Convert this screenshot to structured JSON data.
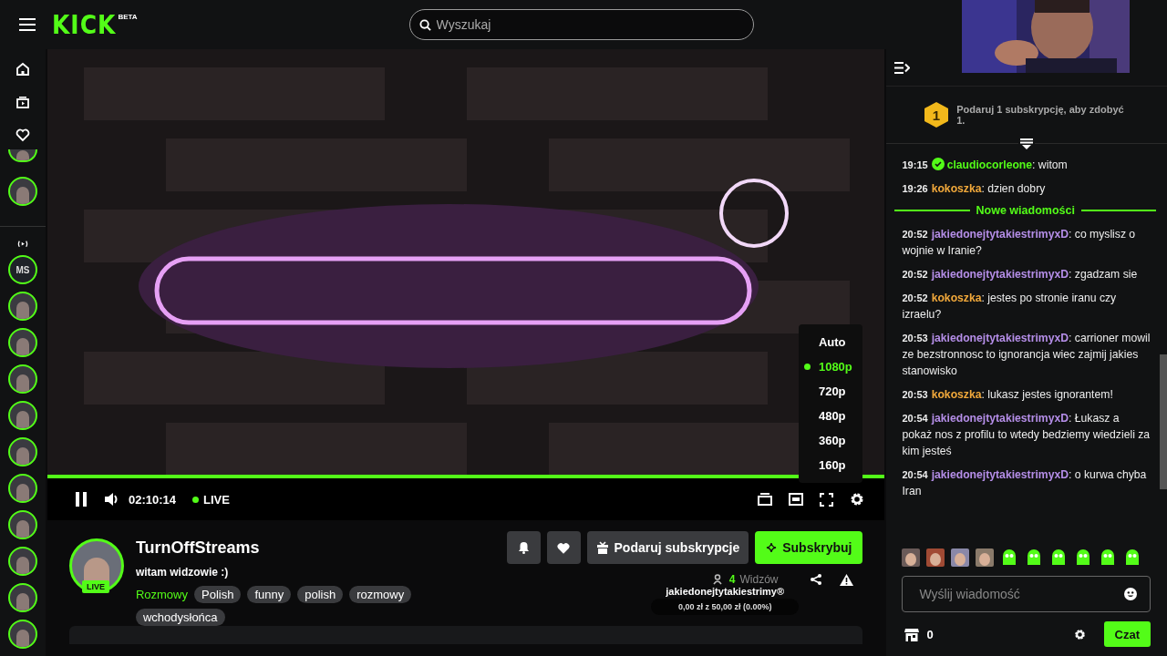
{
  "header": {
    "logo": "KICK",
    "logo_badge": "BETA",
    "search": {
      "placeholder": "Wyszukaj"
    }
  },
  "sidebar": {
    "followed": [
      {
        "kind": "picture"
      },
      {
        "kind": "picture"
      }
    ],
    "recommended": [
      {
        "kind": "initials",
        "label": "MS"
      },
      {
        "kind": "picture"
      },
      {
        "kind": "picture"
      },
      {
        "kind": "picture"
      },
      {
        "kind": "picture"
      },
      {
        "kind": "picture"
      },
      {
        "kind": "picture"
      },
      {
        "kind": "picture"
      },
      {
        "kind": "picture"
      },
      {
        "kind": "picture"
      },
      {
        "kind": "picture"
      }
    ]
  },
  "player": {
    "quality_menu": [
      {
        "label": "Auto",
        "selected": false
      },
      {
        "label": "1080p",
        "selected": true
      },
      {
        "label": "720p",
        "selected": false
      },
      {
        "label": "480p",
        "selected": false
      },
      {
        "label": "360p",
        "selected": false
      },
      {
        "label": "160p",
        "selected": false
      }
    ],
    "progress": {
      "level": 1.0
    },
    "time": "02:10:14",
    "live_label": "LIVE"
  },
  "stream": {
    "live_badge": "LIVE",
    "channel": "TurnOffStreams",
    "title": "witam widzowie :)",
    "category": "Rozmowy",
    "tags": [
      "Polish",
      "funny",
      "polish",
      "rozmowy",
      "wchodysłońca"
    ],
    "buttons": {
      "gift": "Podaruj subskrypcje",
      "subscribe": "Subskrybuj"
    },
    "viewers": {
      "count": "4",
      "label": "Widzów"
    },
    "goal": {
      "name": "jakiedonejtytakiestrimy®",
      "amount": "0,00 zł z 50,00 zł (0.00%)"
    }
  },
  "chat": {
    "gift_banner": {
      "badge": "1",
      "text": "Podaruj 1 subskrypcję, aby zdobyć 1."
    },
    "messages": [
      {
        "kind": "message",
        "time": "19:15",
        "verified": true,
        "user": "claudiocorleone",
        "color": "#53fc18",
        "text": ": witom"
      },
      {
        "kind": "message",
        "time": "19:26",
        "verified": false,
        "user": "kokoszka",
        "color": "#f2a93b",
        "text": ": dzien dobry"
      },
      {
        "kind": "divider",
        "text": "Nowe wiadomości"
      },
      {
        "kind": "message",
        "time": "20:52",
        "verified": false,
        "user": "jakiedonejtytakiestrimyxD",
        "color": "#b58ee8",
        "text": ": co myslisz o wojnie w Iranie?"
      },
      {
        "kind": "message",
        "time": "20:52",
        "verified": false,
        "user": "jakiedonejtytakiestrimyxD",
        "color": "#b58ee8",
        "text": ": zgadzam sie"
      },
      {
        "kind": "message",
        "time": "20:52",
        "verified": false,
        "user": "kokoszka",
        "color": "#f2a93b",
        "text": ": jestes po stronie iranu czy izraelu?"
      },
      {
        "kind": "message",
        "time": "20:53",
        "verified": false,
        "user": "jakiedonejtytakiestrimyxD",
        "color": "#b58ee8",
        "text": ": carrioner mowil ze bezstronnosc to ignorancja wiec zajmij jakies stanowisko"
      },
      {
        "kind": "message",
        "time": "20:53",
        "verified": false,
        "user": "kokoszka",
        "color": "#f2a93b",
        "text": ": lukasz jestes ignorantem!"
      },
      {
        "kind": "message",
        "time": "20:54",
        "verified": false,
        "user": "jakiedonejtytakiestrimyxD",
        "color": "#b58ee8",
        "text": ": Łukasz a pokaż nos z profilu to wtedy bedziemy wiedzieli za kim jesteś"
      },
      {
        "kind": "message",
        "time": "20:54",
        "verified": false,
        "user": "jakiedonejtytakiestrimyxD",
        "color": "#b58ee8",
        "text": ": o kurwa chyba Iran"
      }
    ],
    "emotes": [
      {
        "kind": "picture"
      },
      {
        "kind": "picture"
      },
      {
        "kind": "picture"
      },
      {
        "kind": "picture"
      },
      {
        "kind": "blob"
      },
      {
        "kind": "blob"
      },
      {
        "kind": "blob"
      },
      {
        "kind": "blob"
      },
      {
        "kind": "blob"
      },
      {
        "kind": "blob"
      }
    ],
    "input": {
      "placeholder": "Wyślij wiadomość"
    },
    "points": "0",
    "send_button": "Czat"
  }
}
